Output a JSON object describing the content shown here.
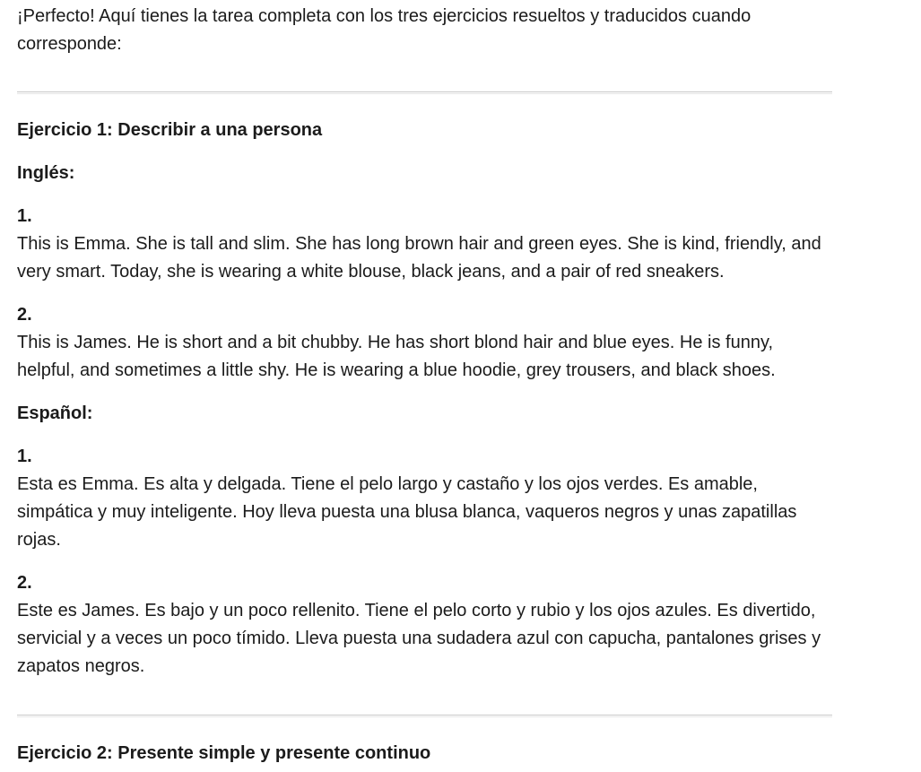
{
  "intro": "¡Perfecto! Aquí tienes la tarea completa con los tres ejercicios resueltos y traducidos cuando corresponde:",
  "exercise1": {
    "title": "Ejercicio 1: Describir a una persona",
    "english": {
      "label": "Inglés:",
      "items": [
        {
          "number": "1.",
          "text": "This is Emma. She is tall and slim. She has long brown hair and green eyes. She is kind, friendly, and very smart. Today, she is wearing a white blouse, black jeans, and a pair of red sneakers."
        },
        {
          "number": "2.",
          "text": "This is James. He is short and a bit chubby. He has short blond hair and blue eyes. He is funny, helpful, and sometimes a little shy. He is wearing a blue hoodie, grey trousers, and black shoes."
        }
      ]
    },
    "spanish": {
      "label": "Español:",
      "items": [
        {
          "number": "1.",
          "text": "Esta es Emma. Es alta y delgada. Tiene el pelo largo y castaño y los ojos verdes. Es amable, simpática y muy inteligente. Hoy lleva puesta una blusa blanca, vaqueros negros y unas zapatillas rojas."
        },
        {
          "number": "2.",
          "text": "Este es James. Es bajo y un poco rellenito. Tiene el pelo corto y rubio y los ojos azules. Es divertido, servicial y a veces un poco tímido. Lleva puesta una sudadera azul con capucha, pantalones grises y zapatos negros."
        }
      ]
    }
  },
  "exercise2": {
    "title": "Ejercicio 2: Presente simple y presente continuo"
  }
}
